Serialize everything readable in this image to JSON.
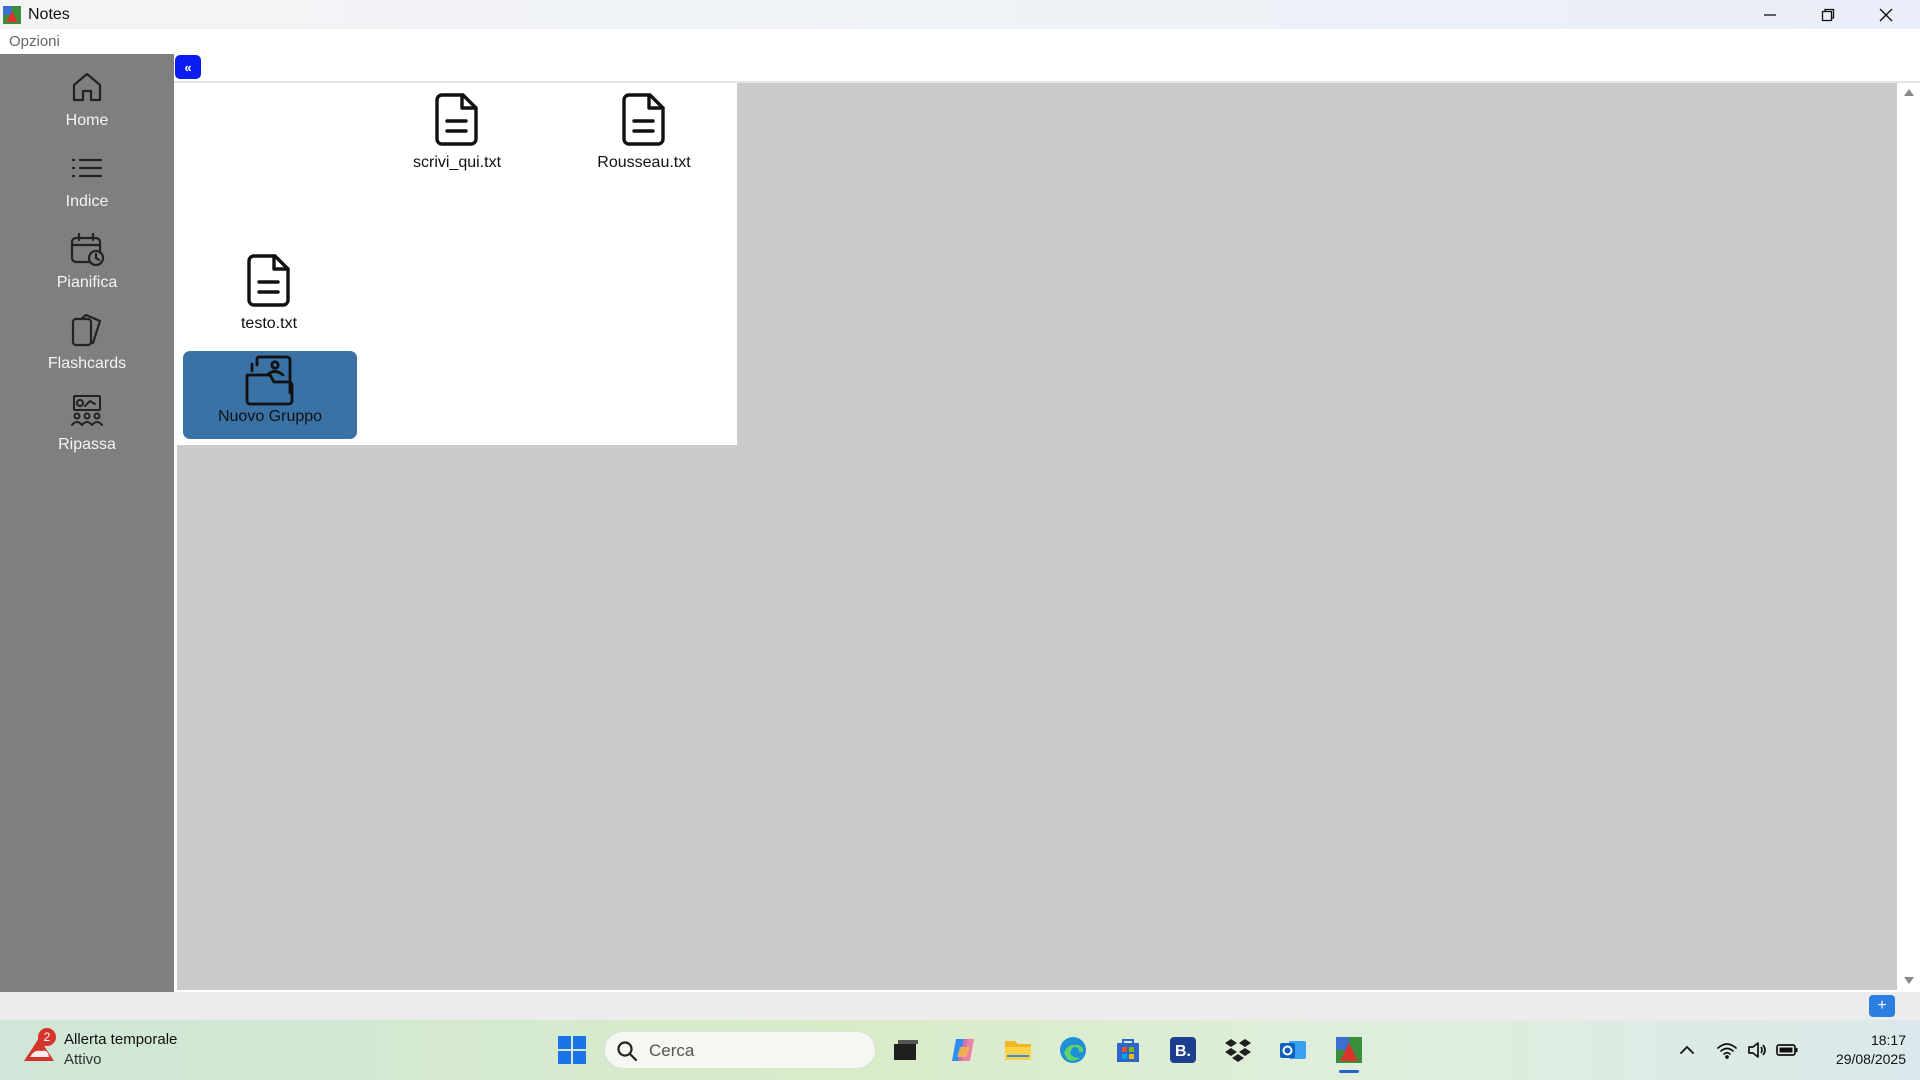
{
  "window": {
    "title": "Notes",
    "controls": [
      "minimize-icon",
      "restore-icon",
      "close-icon"
    ]
  },
  "menu": {
    "options_label": "Opzioni"
  },
  "sidebar": {
    "items": [
      {
        "label": "Home",
        "icon": "home-icon"
      },
      {
        "label": "Indice",
        "icon": "list-icon"
      },
      {
        "label": "Pianifica",
        "icon": "calendar-clock-icon"
      },
      {
        "label": "Flashcards",
        "icon": "cards-icon"
      },
      {
        "label": "Ripassa",
        "icon": "review-icon"
      }
    ]
  },
  "content": {
    "collapse_label": "«",
    "files": [
      {
        "name": "scrivi_qui.txt",
        "icon": "file-text-icon"
      },
      {
        "name": "Rousseau.txt",
        "icon": "file-text-icon"
      },
      {
        "name": "testo.txt",
        "icon": "file-text-icon"
      }
    ],
    "new_group_label": "Nuovo Gruppo",
    "add_label": "+"
  },
  "taskbar": {
    "weather": {
      "badge": "2",
      "title": "Allerta temporale",
      "status": "Attivo"
    },
    "search_placeholder": "Cerca",
    "apps": [
      "windows-start-icon",
      "task-view-icon",
      "copilot-icon",
      "file-explorer-icon",
      "edge-icon",
      "store-icon",
      "booking-icon",
      "dropbox-icon",
      "outlook-icon",
      "notes-app-icon"
    ],
    "tray": [
      "chevron-up-icon",
      "wifi-icon",
      "volume-icon",
      "battery-icon"
    ],
    "time": "18:17",
    "date": "29/08/2025"
  },
  "colors": {
    "sidebar_bg": "#7f7f7f",
    "workspace_bg": "#cbcbcb",
    "group_button": "#3a72a6",
    "collapse_button": "#0b1cf0",
    "add_button": "#2a7fe0"
  }
}
